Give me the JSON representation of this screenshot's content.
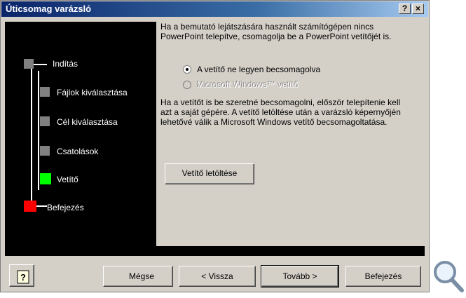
{
  "window": {
    "title": "Úticsomag varázsló",
    "help_btn": "?",
    "close_btn": "×"
  },
  "steps": [
    {
      "label": "Indítás",
      "color": "#808080"
    },
    {
      "label": "Fájlok kiválasztása",
      "color": "#808080"
    },
    {
      "label": "Cél kiválasztása",
      "color": "#808080"
    },
    {
      "label": "Csatolások",
      "color": "#808080"
    },
    {
      "label": "Vetítő",
      "color": "#00ff00"
    },
    {
      "label": "Befejezés",
      "color": "#ff0000"
    }
  ],
  "content": {
    "intro": "Ha a bemutató lejátszására használt számítógépen nincs PowerPoint telepítve, csomagolja be a PowerPoint vetítőjét is.",
    "options": [
      {
        "label": "A vetítő ne legyen becsomagolva",
        "selected": true,
        "enabled": true
      },
      {
        "label": "Microsoft Windows™ vetítő",
        "selected": false,
        "enabled": false
      }
    ],
    "info": "Ha a vetítőt is be szeretné becsomagolni, először telepítenie kell azt a saját gépére. A vetítő letöltése után a varázsló képernyőjén lehetővé válik a Microsoft Windows vetítő becsomagoltatása.",
    "download_button": "Vetítő letöltése"
  },
  "footer": {
    "cancel": "Mégse",
    "back": "< Vissza",
    "next": "Tovább >",
    "finish": "Befejezés"
  }
}
